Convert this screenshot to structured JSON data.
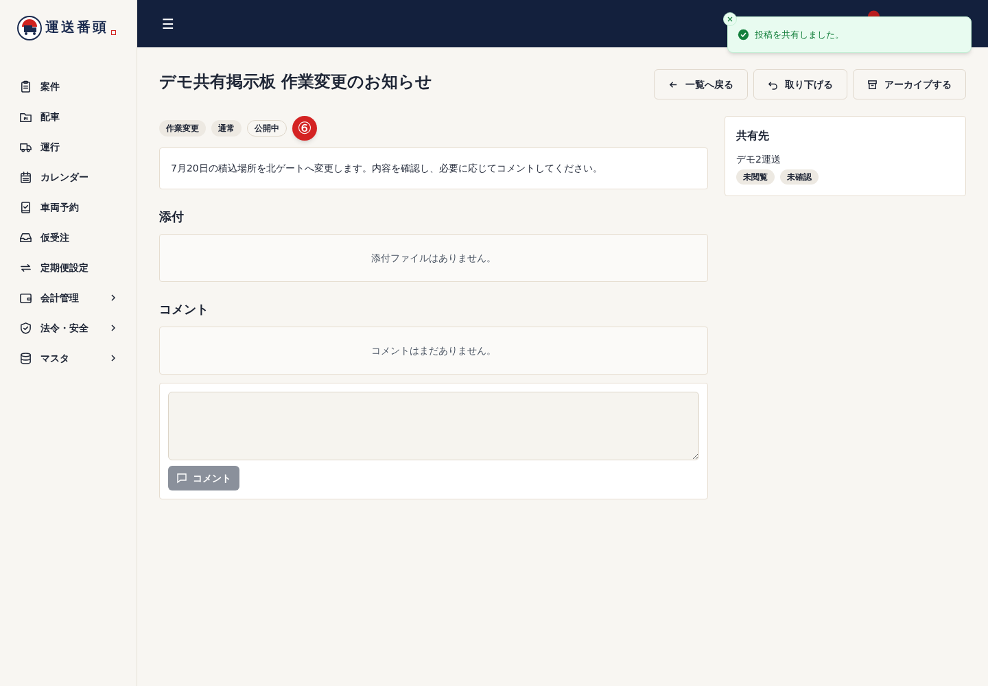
{
  "logo": {
    "text": "運送番頭"
  },
  "sidebar": {
    "items": [
      {
        "label": "案件",
        "expandable": false
      },
      {
        "label": "配車",
        "expandable": false
      },
      {
        "label": "運行",
        "expandable": false
      },
      {
        "label": "カレンダー",
        "expandable": false
      },
      {
        "label": "車両予約",
        "expandable": false
      },
      {
        "label": "仮受注",
        "expandable": false
      },
      {
        "label": "定期便設定",
        "expandable": false
      },
      {
        "label": "会計管理",
        "expandable": true
      },
      {
        "label": "法令・安全",
        "expandable": true
      },
      {
        "label": "マスタ",
        "expandable": true
      }
    ]
  },
  "header": {
    "menu_icon": "☰"
  },
  "toast": {
    "message": "投稿を共有しました。"
  },
  "page": {
    "title": "デモ共有掲示板 作業変更のお知らせ",
    "actions": [
      {
        "label": "一覧へ戻る"
      },
      {
        "label": "取り下げる"
      },
      {
        "label": "アーカイブする"
      }
    ],
    "tags": [
      {
        "label": "作業変更",
        "kind": "filled"
      },
      {
        "label": "通常",
        "kind": "filled"
      },
      {
        "label": "公開中",
        "kind": "outline"
      }
    ],
    "step_marker": "⑥",
    "body": "7月20日の積込場所を北ゲートへ変更します。内容を確認し、必要に応じてコメントしてください。",
    "attachments": {
      "heading": "添付",
      "empty": "添付ファイルはありません。"
    },
    "comments": {
      "heading": "コメント",
      "empty": "コメントはまだありません。",
      "button": "コメント",
      "button_disabled": true
    }
  },
  "shared": {
    "heading": "共有先",
    "recipients": [
      {
        "name": "デモ2運送",
        "badges": [
          "未閲覧",
          "未確認"
        ]
      }
    ]
  }
}
